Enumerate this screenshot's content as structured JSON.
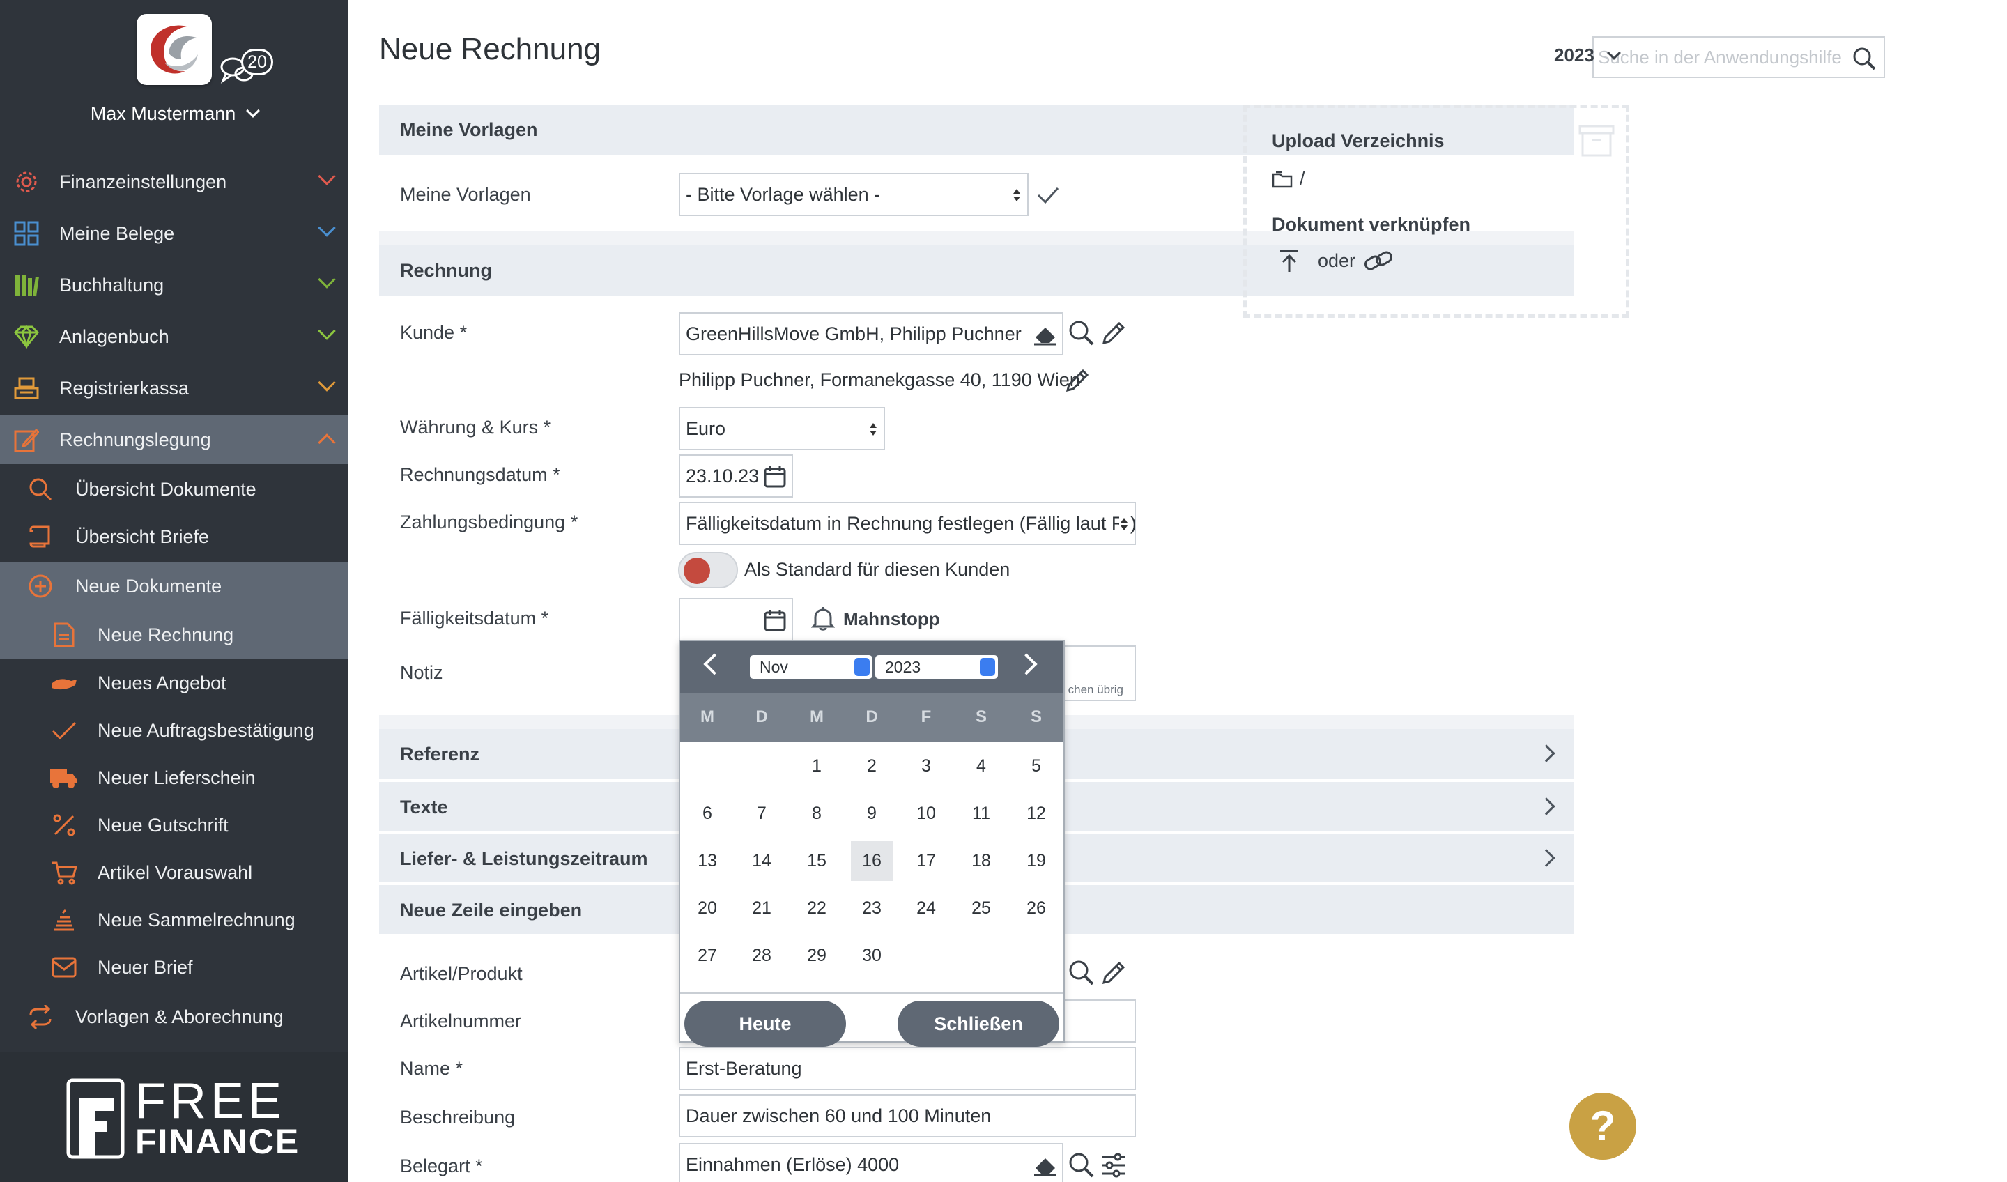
{
  "user": {
    "name": "Max Mustermann",
    "chat_count": "20"
  },
  "sidebar": {
    "items": [
      {
        "label": "Finanzeinstellungen",
        "icon": "gear-icon",
        "color": "#e05a4e"
      },
      {
        "label": "Meine Belege",
        "icon": "grid-icon",
        "color": "#4a8fd0"
      },
      {
        "label": "Buchhaltung",
        "icon": "books-icon",
        "color": "#7fb33a"
      },
      {
        "label": "Anlagenbuch",
        "icon": "diamond-icon",
        "color": "#8cc63f"
      },
      {
        "label": "Registrierkassa",
        "icon": "register-icon",
        "color": "#e09a3a"
      },
      {
        "label": "Rechnungslegung",
        "icon": "edit-icon",
        "color": "#e8743a"
      }
    ],
    "sub_items": [
      {
        "label": "Übersicht Dokumente",
        "icon": "search-icon"
      },
      {
        "label": "Übersicht Briefe",
        "icon": "scroll-icon"
      },
      {
        "label": "Neue Dokumente",
        "icon": "plus-circle-icon"
      }
    ],
    "doc_items": [
      {
        "label": "Neue Rechnung",
        "icon": "document-icon"
      },
      {
        "label": "Neues Angebot",
        "icon": "handshake-icon"
      },
      {
        "label": "Neue Auftragsbestätigung",
        "icon": "check-icon"
      },
      {
        "label": "Neuer Lieferschein",
        "icon": "truck-icon"
      },
      {
        "label": "Neue Gutschrift",
        "icon": "percent-icon"
      },
      {
        "label": "Artikel Vorauswahl",
        "icon": "cart-icon"
      },
      {
        "label": "Neue Sammelrechnung",
        "icon": "stack-icon"
      },
      {
        "label": "Neuer Brief",
        "icon": "envelope-icon"
      }
    ],
    "templates_item": {
      "label": "Vorlagen & Aborechnung",
      "icon": "repeat-icon"
    },
    "logo_text": {
      "top": "FREE",
      "bottom": "FINANCE"
    }
  },
  "page": {
    "title": "Neue Rechnung"
  },
  "templates": {
    "heading": "Meine Vorlagen",
    "label": "Meine Vorlagen",
    "select_value": "- Bitte Vorlage wählen -"
  },
  "invoice": {
    "heading": "Rechnung",
    "customer_label": "Kunde *",
    "customer_value": "GreenHillsMove GmbH, Philipp Puchner",
    "customer_address": "Philipp Puchner, Formanekgasse 40, 1190 Wien",
    "currency_label": "Währung & Kurs *",
    "currency_value": "Euro",
    "date_label": "Rechnungsdatum *",
    "date_value": "23.10.23",
    "terms_label": "Zahlungsbedingung *",
    "terms_value": "Fälligkeitsdatum in Rechnung festlegen (Fällig laut R.)",
    "default_label": "Als Standard für diesen Kunden",
    "due_label": "Fälligkeitsdatum *",
    "due_value": "",
    "dunning_stop": "Mahnstopp",
    "note_label": "Notiz",
    "note_counter": "chen übrig"
  },
  "sections": {
    "reference": "Referenz",
    "texts": "Texte",
    "delivery": "Liefer- & Leistungszeitraum",
    "new_line": "Neue Zeile eingeben"
  },
  "line": {
    "product_label": "Artikel/Produkt",
    "number_label": "Artikelnummer",
    "name_label": "Name *",
    "name_value": "Erst-Beratung",
    "desc_label": "Beschreibung",
    "desc_value": "Dauer zwischen 60 und 100 Minuten",
    "type_label": "Belegart *",
    "type_value": "Einnahmen (Erlöse) 4000"
  },
  "datepicker": {
    "month": "Nov",
    "year": "2023",
    "weekdays": [
      "M",
      "D",
      "M",
      "D",
      "F",
      "S",
      "S"
    ],
    "days": [
      "1",
      "2",
      "3",
      "4",
      "5",
      "6",
      "7",
      "8",
      "9",
      "10",
      "11",
      "12",
      "13",
      "14",
      "15",
      "16",
      "17",
      "18",
      "19",
      "20",
      "21",
      "22",
      "23",
      "24",
      "25",
      "26",
      "27",
      "28",
      "29",
      "30"
    ],
    "highlighted_day": "16",
    "today_button": "Heute",
    "close_button": "Schließen"
  },
  "right": {
    "search_placeholder": "Suche in der Anwendungshilfe",
    "year": "2023",
    "upload_title": "Upload Verzeichnis",
    "upload_path": "/",
    "link_title": "Dokument verknüpfen",
    "link_or": "oder"
  },
  "help": {
    "label": "?"
  },
  "colors": {
    "sidebar_bg": "#2f343b",
    "active_bg": "#5f6874",
    "accent": "#c44a3e",
    "help": "#c9a144"
  }
}
